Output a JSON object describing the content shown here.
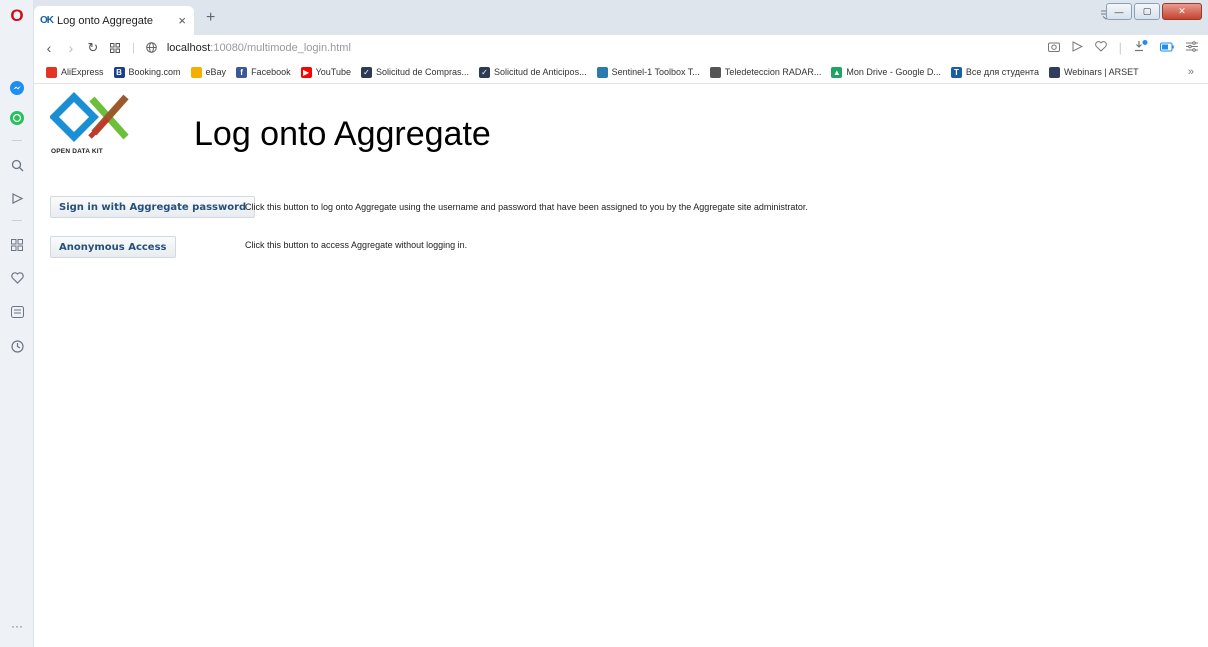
{
  "browser": {
    "tab": {
      "favicon": "OK",
      "title": "Log onto Aggregate",
      "close": "×"
    },
    "new_tab": "+",
    "address": {
      "host": "localhost",
      "path": ":10080/multimode_login.html"
    },
    "bookmarks": [
      {
        "label": "AliExpress",
        "icon_color": "#e43225",
        "glyph": ""
      },
      {
        "label": "Booking.com",
        "icon_color": "#1e3e8c",
        "glyph": "B"
      },
      {
        "label": "eBay",
        "icon_color": "#f5af02",
        "glyph": ""
      },
      {
        "label": "Facebook",
        "icon_color": "#3b5998",
        "glyph": "f"
      },
      {
        "label": "YouTube",
        "icon_color": "#ff0000",
        "glyph": "▶"
      },
      {
        "label": "Solicitud de Compras...",
        "icon_color": "#2b3a55",
        "glyph": "✓"
      },
      {
        "label": "Solicitud de Anticipos...",
        "icon_color": "#2b3a55",
        "glyph": "✓"
      },
      {
        "label": "Sentinel-1 Toolbox T...",
        "icon_color": "#2a7ab0",
        "glyph": ""
      },
      {
        "label": "Teledeteccion RADAR...",
        "icon_color": "#555555",
        "glyph": ""
      },
      {
        "label": "Mon Drive - Google D...",
        "icon_color": "#1fa463",
        "glyph": "▲"
      },
      {
        "label": "Все для студента",
        "icon_color": "#1b5fa0",
        "glyph": "T"
      },
      {
        "label": "Webinars | ARSET",
        "icon_color": "#2e3e5c",
        "glyph": ""
      }
    ],
    "bookmarks_more": "»"
  },
  "page": {
    "logo_text": "OPEN DATA KIT",
    "title": "Log onto Aggregate",
    "options": [
      {
        "button": "Sign in with Aggregate password",
        "description": "Click this button to log onto Aggregate using the username and password that have been assigned to you by the Aggregate site administrator."
      },
      {
        "button": "Anonymous Access",
        "description": "Click this button to access Aggregate without logging in."
      }
    ]
  },
  "sidebar": {
    "more": "···"
  }
}
